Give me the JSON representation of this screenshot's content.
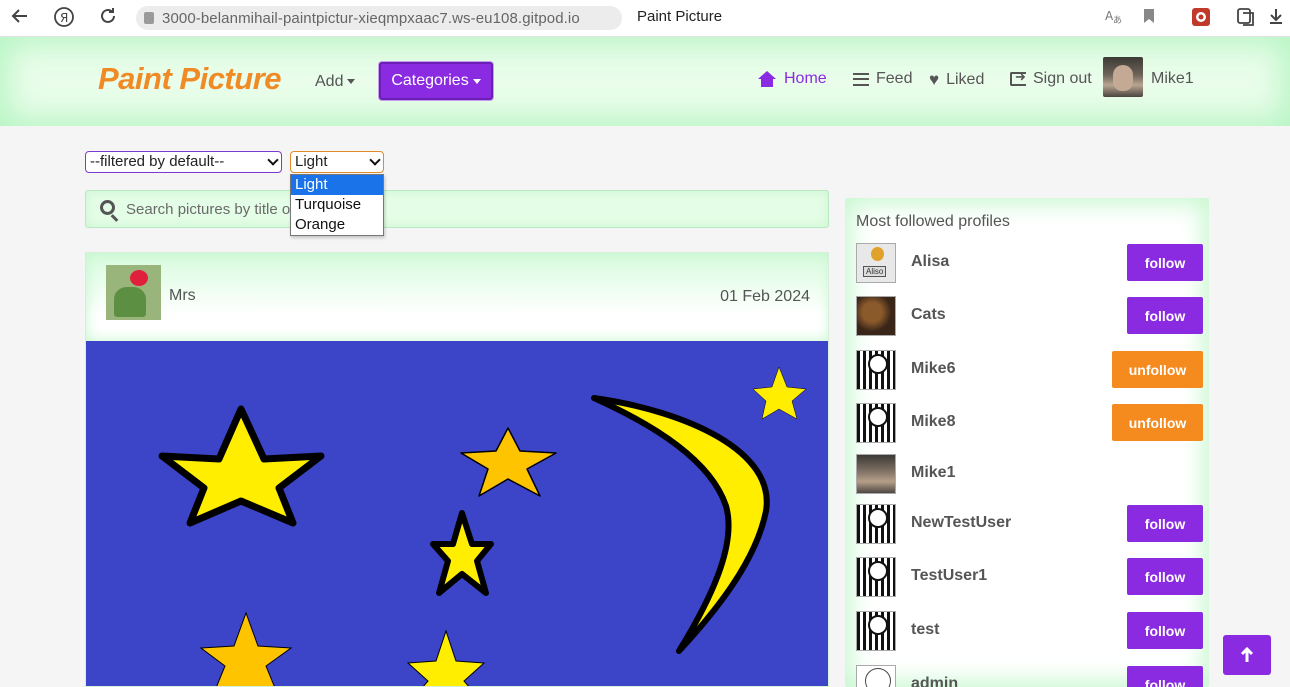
{
  "browser": {
    "url": "3000-belanmihail-paintpictur-xieqmpxaac7.ws-eu108.gitpod.io",
    "tab_title": "Paint Picture",
    "back_icon": "arrow-left-icon",
    "yandex_icon": "yandex-logo-icon",
    "reload_icon": "reload-icon"
  },
  "navbar": {
    "brand": "Paint Picture",
    "add_label": "Add",
    "categories_label": "Categories",
    "home_label": "Home",
    "feed_label": "Feed",
    "liked_label": "Liked",
    "signout_label": "Sign out",
    "username": "Mike1"
  },
  "filters": {
    "default_select": "--filtered by default--",
    "theme_select": "Light",
    "theme_options": [
      "Light",
      "Turquoise",
      "Orange"
    ]
  },
  "search": {
    "placeholder": "Search pictures by title o"
  },
  "post": {
    "author": "Mrs",
    "date": "01 Feb 2024"
  },
  "sidebar": {
    "title": "Most followed profiles",
    "profiles": [
      {
        "name": "Alisa",
        "action": "follow"
      },
      {
        "name": "Cats",
        "action": "follow"
      },
      {
        "name": "Mike6",
        "action": "unfollow"
      },
      {
        "name": "Mike8",
        "action": "unfollow"
      },
      {
        "name": "Mike1",
        "action": ""
      },
      {
        "name": "NewTestUser",
        "action": "follow"
      },
      {
        "name": "TestUser1",
        "action": "follow"
      },
      {
        "name": "test",
        "action": "follow"
      },
      {
        "name": "admin",
        "action": "follow"
      }
    ]
  },
  "colors": {
    "accent": "#8a2be2",
    "brand": "#f08a24",
    "unfollow": "#f58a1f",
    "navbar_bg": "#e9fdea"
  }
}
